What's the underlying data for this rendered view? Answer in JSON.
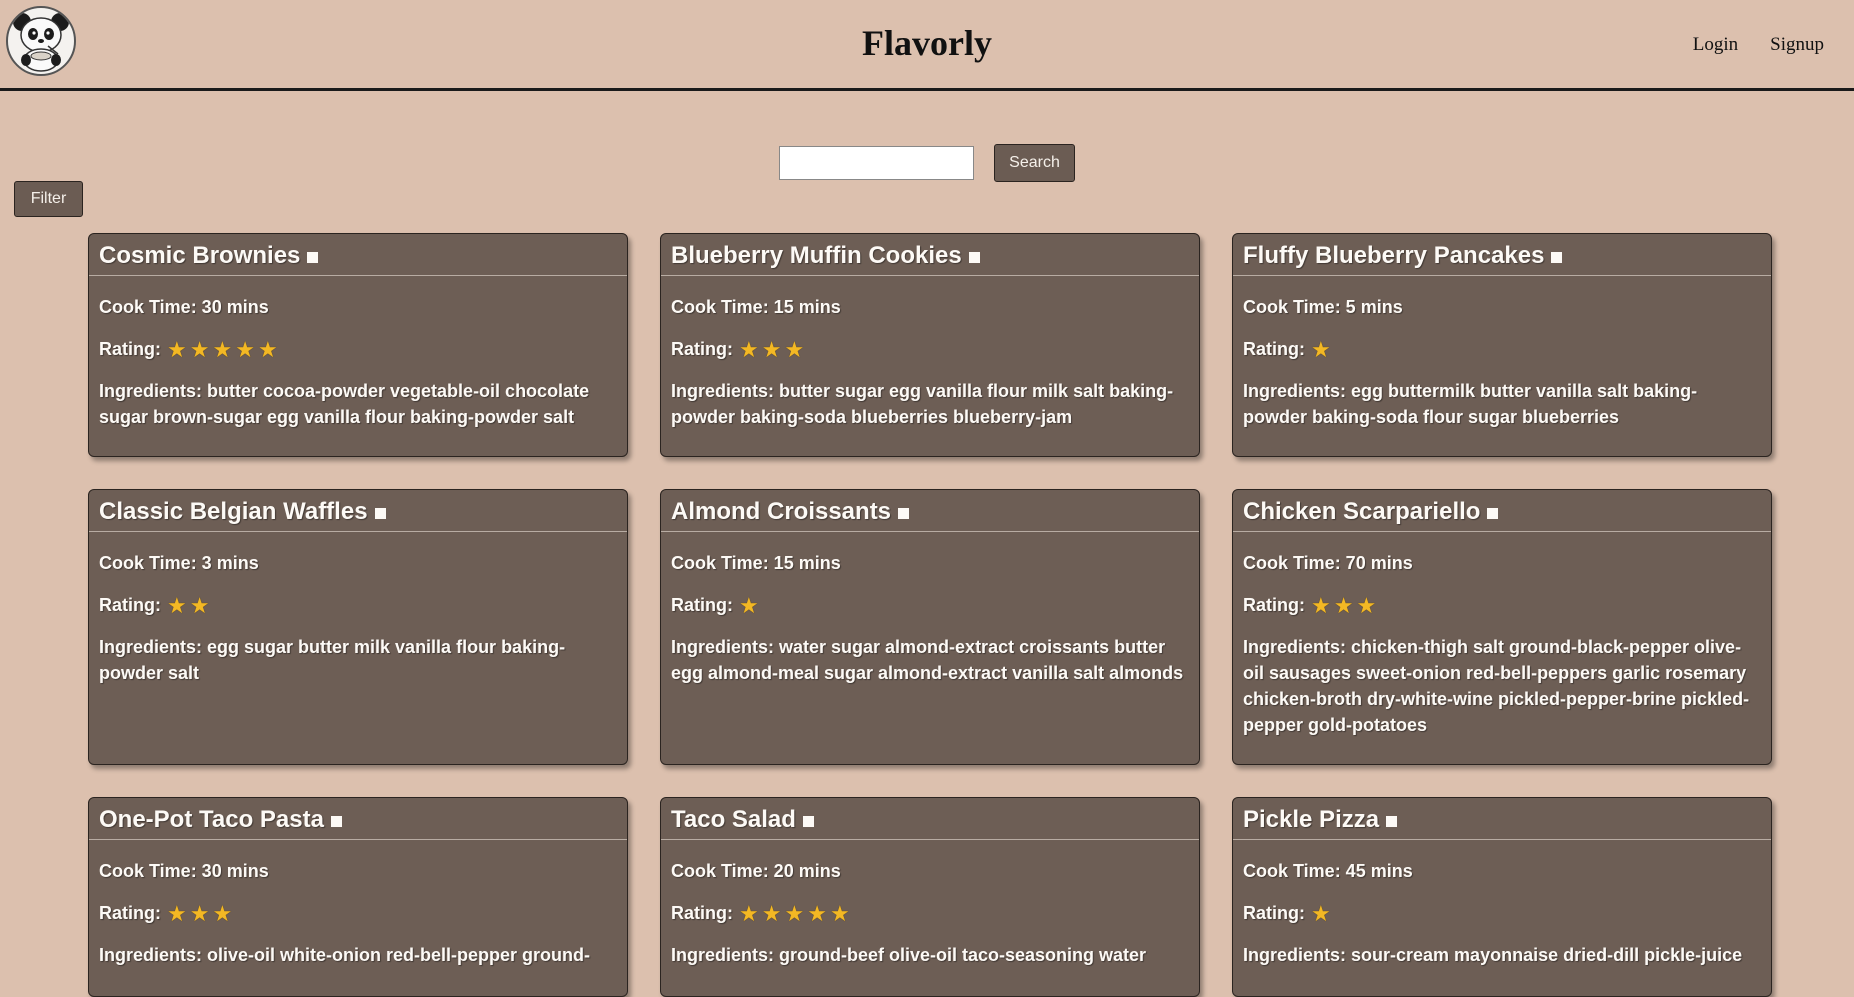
{
  "site": {
    "title": "Flavorly",
    "logo_icon": "panda-logo-icon",
    "nav": {
      "login": "Login",
      "signup": "Signup"
    }
  },
  "search": {
    "placeholder": "",
    "value": "",
    "button_label": "Search"
  },
  "filter": {
    "button_label": "Filter"
  },
  "labels": {
    "cook_time_prefix": "Cook Time: ",
    "rating_prefix": "Rating:",
    "ingredients_prefix": "Ingredients: "
  },
  "colors": {
    "background": "#dcc0ae",
    "card": "#6d5e55",
    "star": "#f3b824",
    "button": "#6b5c53"
  },
  "recipes": [
    {
      "title": "Cosmic Brownies",
      "cook_time": "30 mins",
      "rating": 5,
      "ingredients": "butter cocoa-powder vegetable-oil chocolate sugar brown-sugar egg vanilla flour baking-powder salt"
    },
    {
      "title": "Blueberry Muffin Cookies",
      "cook_time": "15 mins",
      "rating": 3,
      "ingredients": "butter sugar egg vanilla flour milk salt baking-powder baking-soda blueberries blueberry-jam"
    },
    {
      "title": "Fluffy Blueberry Pancakes",
      "cook_time": "5 mins",
      "rating": 1,
      "ingredients": "egg buttermilk butter vanilla salt baking-powder baking-soda flour sugar blueberries"
    },
    {
      "title": "Classic Belgian Waffles",
      "cook_time": "3 mins",
      "rating": 2,
      "ingredients": "egg sugar butter milk vanilla flour baking-powder salt"
    },
    {
      "title": "Almond Croissants",
      "cook_time": "15 mins",
      "rating": 1,
      "ingredients": "water sugar almond-extract croissants butter egg almond-meal sugar almond-extract vanilla salt almonds"
    },
    {
      "title": "Chicken Scarpariello",
      "cook_time": "70 mins",
      "rating": 3,
      "ingredients": "chicken-thigh salt ground-black-pepper olive-oil sausages sweet-onion red-bell-peppers garlic rosemary chicken-broth dry-white-wine pickled-pepper-brine pickled-pepper gold-potatoes"
    },
    {
      "title": "One-Pot Taco Pasta",
      "cook_time": "30 mins",
      "rating": 3,
      "ingredients": "olive-oil white-onion red-bell-pepper ground-"
    },
    {
      "title": "Taco Salad",
      "cook_time": "20 mins",
      "rating": 5,
      "ingredients": "ground-beef olive-oil taco-seasoning water"
    },
    {
      "title": "Pickle Pizza",
      "cook_time": "45 mins",
      "rating": 1,
      "ingredients": "sour-cream mayonnaise dried-dill pickle-juice"
    }
  ]
}
